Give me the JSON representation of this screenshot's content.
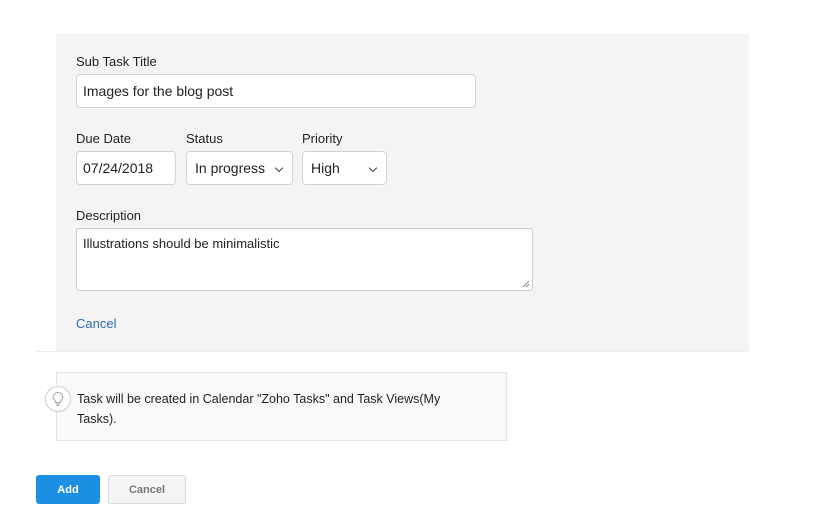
{
  "form": {
    "title_label": "Sub Task Title",
    "title_value": "Images for the blog post",
    "due_date_label": "Due Date",
    "due_date_value": "07/24/2018",
    "status_label": "Status",
    "status_value": "In progress",
    "priority_label": "Priority",
    "priority_value": "High",
    "description_label": "Description",
    "description_value": "Illustrations should be minimalistic",
    "cancel_link": "Cancel"
  },
  "info": {
    "icon": "lightbulb-icon",
    "text": "Task will be created in Calendar \"Zoho Tasks\" and Task Views(My Tasks)."
  },
  "actions": {
    "add_label": "Add",
    "cancel_label": "Cancel",
    "add_color": "#1d8fe3"
  }
}
